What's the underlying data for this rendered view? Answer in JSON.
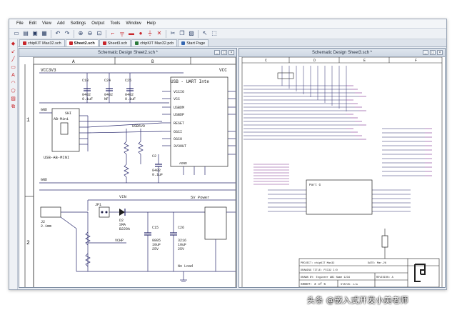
{
  "menu": {
    "items": [
      "File",
      "Edit",
      "View",
      "Add",
      "Settings",
      "Output",
      "Tools",
      "Window",
      "Help"
    ]
  },
  "toolbar": {
    "icons": [
      "new-icon",
      "open-icon",
      "save-icon",
      "print-icon",
      "undo-icon",
      "redo-icon",
      "zoom-in-icon",
      "zoom-out-icon",
      "zoom-fit-icon",
      "wire-icon",
      "bus-icon",
      "label-icon",
      "junction-icon",
      "power-icon",
      "delete-icon",
      "cut-icon",
      "copy-icon",
      "paste-icon",
      "pointer-icon",
      "select-icon"
    ]
  },
  "tabs": [
    {
      "label": "chipKIT Max32.sch",
      "color": "#c8262b"
    },
    {
      "label": "Sheet2.sch",
      "color": "#c8262b"
    },
    {
      "label": "Sheet3.sch",
      "color": "#c8262b"
    },
    {
      "label": "chipKIT Max32.pcb",
      "color": "#2b7a3a"
    },
    {
      "label": "Start Page",
      "color": "#3466b0"
    }
  ],
  "left_panel": {
    "title": "Schematic Design Sheet2.sch *",
    "columns": [
      "A",
      "B"
    ],
    "rows": [
      "1",
      "2"
    ],
    "texts": {
      "vcc3v3": "VCC3V3",
      "vcc": "VCC",
      "usb_uart": "USB - UART Inte",
      "c18": "C18",
      "c18_pkg": "0402",
      "c18_val": "0.1uF",
      "c24": "C24",
      "c24_pkg": "0402",
      "c24_val": "NF",
      "c25": "C25",
      "c25_pkg": "0402",
      "c25_val": "0.1uF",
      "gnd": "GND",
      "shi": "SHI",
      "ab_mini": "AB-Mini",
      "usb_ab_mini": "USB-AB-MINI",
      "usb5vd": "USB5VD",
      "vcco": "VCCIO",
      "vcc_pin": "VCC",
      "usbdm": "USBDM",
      "usbdp": "USBDP",
      "reset": "RESET",
      "osci": "OSCI",
      "osco": "OSCO",
      "3v3out": "3V3OUT",
      "c2": "C2",
      "c2_pkg": "0402",
      "c2_val": "0.1uF",
      "vin": "VIN",
      "jp1": "JP1",
      "d2": "D2",
      "d2_pkg": "SMA",
      "d2_part": "B220A",
      "vchp": "VCHP",
      "c15": "C15",
      "c15_pkg": "0805",
      "c15_val": "10uF",
      "c15_v": "25V",
      "c26": "C26",
      "c26_pkg": "3216",
      "c26_val": "10uF",
      "c26_v": "25V",
      "power_label": "5V Power",
      "no_load": "No Load",
      "j2": "J2",
      "j2_size": "2.1mm",
      "agnd": "AGND"
    }
  },
  "right_panel": {
    "title": "Schematic Design Sheet3.sch *",
    "columns": [
      "C",
      "D",
      "E",
      "F"
    ],
    "texts": {
      "part_g": "Part G",
      "title_project": "PROJECT: chipKIT Max32",
      "title_drawing": "DRAWING TITLE: PIC32 I/O",
      "title_drawn": "DRAWN BY: Engineer ABC Name 1234",
      "title_sheet": "SHEET: 3 of 5",
      "title_status": "STATUS: n/a",
      "title_date": "DATE: Mar.26",
      "title_rev": "REVISION: A"
    }
  },
  "watermark": "头条 @嵌入式开发小美老师",
  "colors": {
    "wire": "#2a2a6e",
    "bus": "#7b2c8e",
    "component": "#1f1f1f",
    "net_label": "#6a2a7a",
    "accent_red": "#c8262b"
  }
}
